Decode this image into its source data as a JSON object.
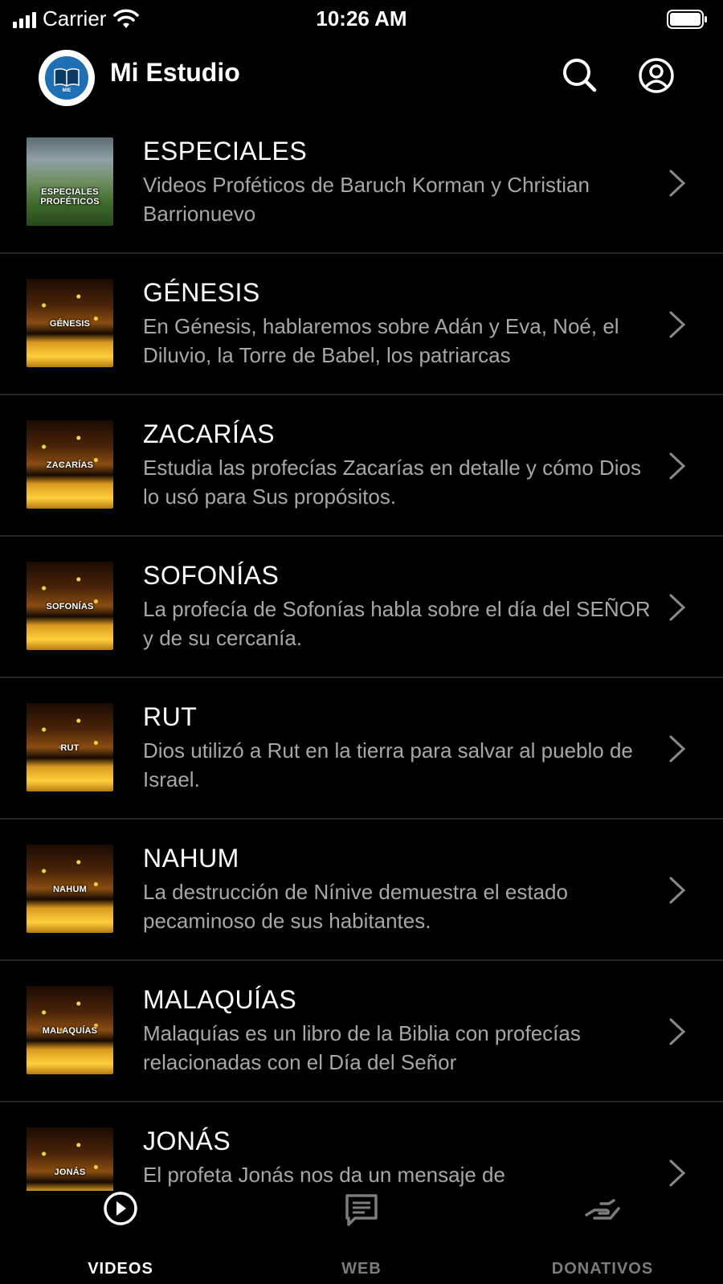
{
  "status": {
    "carrier": "Carrier",
    "time": "10:26 AM"
  },
  "header": {
    "title": "Mi Estudio",
    "logo_text": "MIE"
  },
  "items": [
    {
      "title": "ESPECIALES",
      "thumb_label": "ESPECIALES PROFÉTICOS",
      "thumb_style": "especial",
      "description": "Videos Proféticos de Baruch Korman y Christian Barrionuevo"
    },
    {
      "title": "GÉNESIS",
      "thumb_label": "GÉNESIS",
      "thumb_style": "fire",
      "description": "En Génesis, hablaremos sobre Adán y Eva, Noé, el Diluvio, la Torre de Babel, los patriarcas"
    },
    {
      "title": "ZACARÍAS",
      "thumb_label": "ZACARÍAS",
      "thumb_style": "fire",
      "description": "Estudia las profecías Zacarías en detalle y cómo Dios lo usó para Sus propósitos."
    },
    {
      "title": "SOFONÍAS",
      "thumb_label": "SOFONÍAS",
      "thumb_style": "fire",
      "description": "La profecía de Sofonías habla sobre el día del SEÑOR y de su cercanía."
    },
    {
      "title": "RUT",
      "thumb_label": "RUT",
      "thumb_style": "fire",
      "description": "Dios utilizó a Rut en la tierra para salvar al pueblo de Israel."
    },
    {
      "title": "NAHUM",
      "thumb_label": "NAHUM",
      "thumb_style": "fire",
      "description": " La destrucción de Nínive demuestra el estado pecaminoso de sus habitantes."
    },
    {
      "title": "MALAQUÍAS",
      "thumb_label": "MALAQUÍAS",
      "thumb_style": "fire",
      "description": "Malaquías es un libro de la Biblia con profecías relacionadas con el Día del Señor"
    },
    {
      "title": "JONÁS",
      "thumb_label": "JONÁS",
      "thumb_style": "fire",
      "description": "El profeta Jonás nos da un mensaje de"
    }
  ],
  "tabs": [
    {
      "label": "VIDEOS",
      "icon": "play-circle-icon",
      "active": true
    },
    {
      "label": "WEB",
      "icon": "web-icon",
      "active": false
    },
    {
      "label": "DONATIVOS",
      "icon": "donate-icon",
      "active": false
    }
  ],
  "colors": {
    "background": "#000000",
    "description": "#a7a7a7",
    "inactive_tab": "#7c7c7c",
    "divider": "#262626"
  }
}
